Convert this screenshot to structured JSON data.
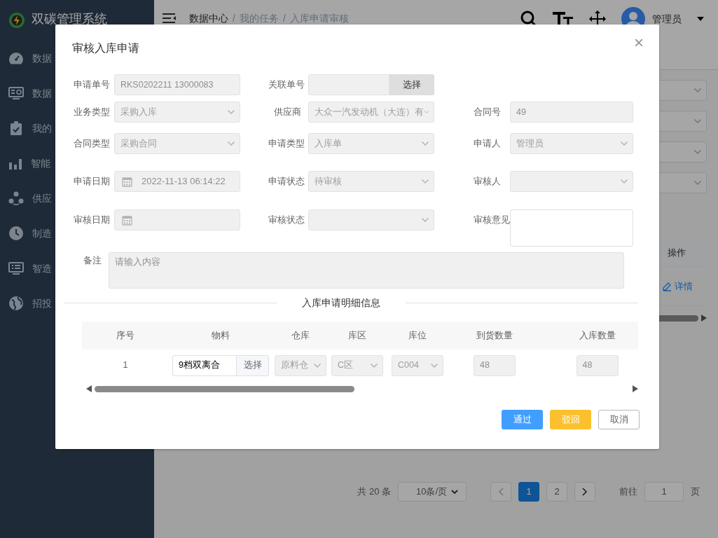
{
  "sidebar": {
    "title": "双碳管理系统",
    "items": [
      {
        "label": "数据"
      },
      {
        "label": "数据"
      },
      {
        "label": "我的"
      },
      {
        "label": "智能"
      },
      {
        "label": "供应"
      },
      {
        "label": "制造"
      },
      {
        "label": "智造"
      },
      {
        "label": "招投"
      }
    ]
  },
  "header": {
    "breadcrumb": [
      "数据中心",
      "我的任务",
      "入库申请审核"
    ],
    "separator": "/",
    "user": "管理员"
  },
  "page": {
    "filters": [
      {
        "kind": "select"
      },
      {
        "kind": "select"
      },
      {
        "kind": "select"
      },
      {
        "kind": "select"
      }
    ],
    "table": {
      "columns": [
        "操作"
      ],
      "rows": [
        {
          "action": "详情"
        }
      ]
    },
    "pagination": {
      "total": "共 20 条",
      "page_size": "10条/页",
      "prev": {
        "disabled": true
      },
      "pages": [
        {
          "label": "1",
          "selected": true
        },
        {
          "label": "2",
          "selected": false
        }
      ],
      "next": {
        "disabled": false
      },
      "goto_label": "前往",
      "goto_value": "1",
      "goto_suffix": "页"
    }
  },
  "dialog": {
    "title": "审核入库申请",
    "close": "×",
    "form_rows": [
      [
        {
          "label": "申请单号",
          "kind": "text",
          "value": "RKS0202211 13000083",
          "disabled": true
        },
        {
          "label": "关联单号",
          "kind": "input-button",
          "button": "选择",
          "disabled": true
        }
      ],
      [
        {
          "label": "业务类型",
          "kind": "select",
          "value": "采购入库",
          "disabled": true
        },
        {
          "label": "供应商",
          "kind": "select",
          "value": "大众一汽发动机（大连）有",
          "disabled": true
        },
        {
          "label": "合同号",
          "kind": "text",
          "value": "49",
          "disabled": true
        }
      ],
      [
        {
          "label": "合同类型",
          "kind": "select",
          "value": "采购合同",
          "disabled": true
        },
        {
          "label": "申请类型",
          "kind": "select",
          "value": "入库单",
          "disabled": true
        },
        {
          "label": "申请人",
          "kind": "select",
          "value": "管理员",
          "disabled": true
        }
      ],
      [
        {
          "label": "申请日期",
          "kind": "date",
          "value": "2022-11-13 06:14:22",
          "disabled": true
        },
        {
          "label": "申请状态",
          "kind": "select",
          "value": "待审核",
          "disabled": true
        },
        {
          "label": "审核人",
          "kind": "select",
          "disabled": true
        }
      ],
      [
        {
          "label": "审核日期",
          "kind": "date",
          "disabled": true
        },
        {
          "label": "审核状态",
          "kind": "select",
          "disabled": true
        },
        {
          "label": "审核意见",
          "kind": "textarea",
          "disabled": false
        }
      ]
    ],
    "remarks": {
      "label": "备注",
      "placeholder": "请输入内容",
      "disabled": true
    },
    "section_title": "入库申请明细信息",
    "detail_table": {
      "columns": [
        {
          "label": "序号",
          "kind": "index"
        },
        {
          "label": "物料",
          "kind": "picker"
        },
        {
          "label": "仓库",
          "kind": "select"
        },
        {
          "label": "库区",
          "kind": "select"
        },
        {
          "label": "库位",
          "kind": "select"
        },
        {
          "label": "到货数量",
          "kind": "input"
        },
        {
          "label": "入库数量",
          "kind": "input"
        }
      ],
      "rows": [
        {
          "cells": [
            {
              "value": "1"
            },
            {
              "value": "9档双离合",
              "button": "选择",
              "disabled": false
            },
            {
              "value": "原料仓",
              "disabled": true
            },
            {
              "value": "C区",
              "disabled": true
            },
            {
              "value": "C004",
              "disabled": true
            },
            {
              "value": "48",
              "disabled": true
            },
            {
              "value": "48",
              "disabled": true
            }
          ]
        }
      ]
    },
    "buttons": [
      {
        "label": "通过",
        "kind": "primary"
      },
      {
        "label": "驳回",
        "kind": "warning"
      },
      {
        "label": "取消",
        "kind": "default"
      }
    ]
  }
}
